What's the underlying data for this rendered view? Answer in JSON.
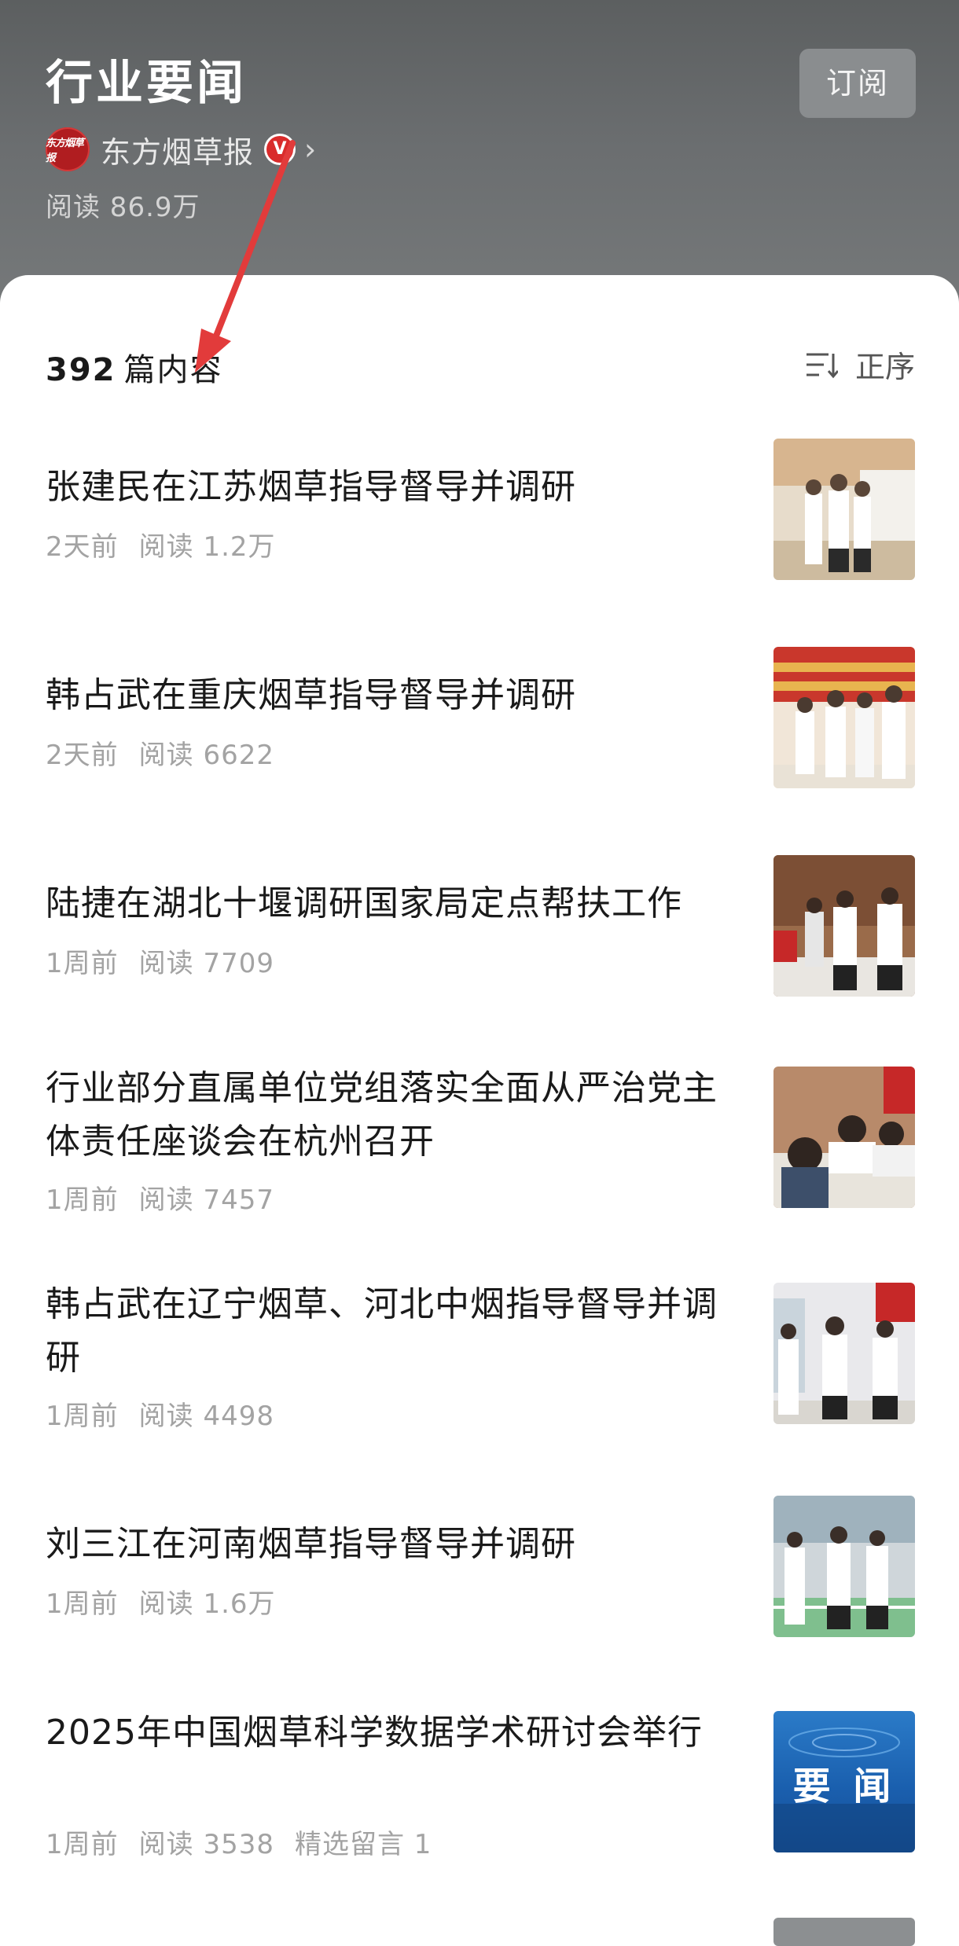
{
  "header": {
    "title": "行业要闻",
    "subscribe_label": "订阅",
    "publisher_name": "东方烟草报",
    "verified_badge": "V",
    "reads_label": "阅读 86.9万"
  },
  "list": {
    "count_number": "392",
    "count_label": "篇内容",
    "sort_label": "正序"
  },
  "articles": [
    {
      "title": "张建民在江苏烟草指导督导并调研",
      "time": "2天前",
      "reads": "阅读 1.2万",
      "extra": ""
    },
    {
      "title": "韩占武在重庆烟草指导督导并调研",
      "time": "2天前",
      "reads": "阅读 6622",
      "extra": ""
    },
    {
      "title": "陆捷在湖北十堰调研国家局定点帮扶工作",
      "time": "1周前",
      "reads": "阅读 7709",
      "extra": ""
    },
    {
      "title": "行业部分直属单位党组落实全面从严治党主体责任座谈会在杭州召开",
      "time": "1周前",
      "reads": "阅读 7457",
      "extra": ""
    },
    {
      "title": "韩占武在辽宁烟草、河北中烟指导督导并调研",
      "time": "1周前",
      "reads": "阅读 4498",
      "extra": ""
    },
    {
      "title": "刘三江在河南烟草指导督导并调研",
      "time": "1周前",
      "reads": "阅读 1.6万",
      "extra": ""
    },
    {
      "title": "2025年中国烟草科学数据学术研讨会举行",
      "time": "1周前",
      "reads": "阅读 3538",
      "extra": "精选留言 1"
    }
  ],
  "thumb_badge_text": "要 闻",
  "colors": {
    "annotation_arrow": "#e23b3b",
    "verify_red": "#d92b2b",
    "header_bg": "#6b6e70"
  }
}
